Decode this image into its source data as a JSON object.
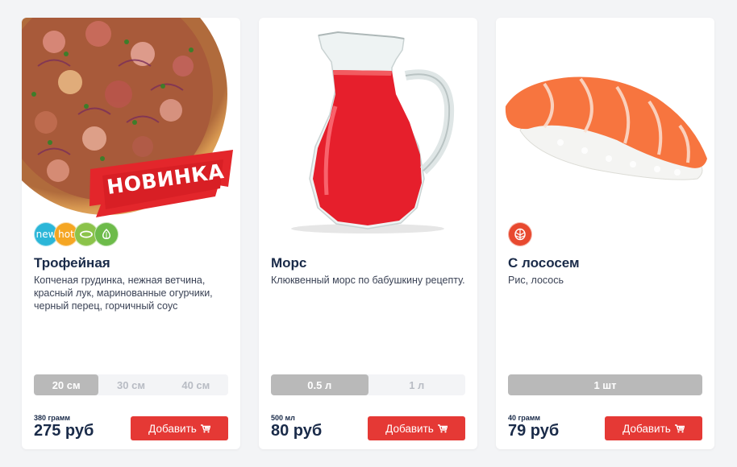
{
  "products": [
    {
      "title": "Трофейная",
      "description": "Копченая грудинка, нежная ветчина, красный лук, маринованные огурчики, черный перец, горчичный соус",
      "promo_label": "НОВИНКА",
      "badges": [
        {
          "icon": "new-icon",
          "text": "new",
          "color": "#2bb6d8"
        },
        {
          "icon": "hot-icon",
          "text": "hot",
          "color": "#f5a623"
        },
        {
          "icon": "pickle-icon",
          "text": "",
          "color": "#8bc34a"
        },
        {
          "icon": "garlic-icon",
          "text": "",
          "color": "#6dbb4a"
        }
      ],
      "sizes": [
        {
          "label": "20 см",
          "active": true
        },
        {
          "label": "30 см",
          "active": false
        },
        {
          "label": "40 см",
          "active": false
        }
      ],
      "weight": "380 грамм",
      "price": "275 руб",
      "add_label": "Добавить"
    },
    {
      "title": "Морс",
      "description": "Клюквенный морс по бабушкину рецепту.",
      "sizes": [
        {
          "label": "0.5 л",
          "active": true
        },
        {
          "label": "1 л",
          "active": false
        }
      ],
      "weight": "500 мл",
      "price": "80 руб",
      "add_label": "Добавить"
    },
    {
      "title": "С лососем",
      "description": "Рис, лосось",
      "badges": [
        {
          "icon": "fish-icon",
          "text": "",
          "color": "#e8492f"
        }
      ],
      "sizes": [
        {
          "label": "1 шт",
          "active": true
        }
      ],
      "weight": "40 грамм",
      "price": "79 руб",
      "add_label": "Добавить"
    }
  ],
  "colors": {
    "accent": "#e53935",
    "text": "#1a2b49",
    "size_active": "#b9b9b9"
  }
}
